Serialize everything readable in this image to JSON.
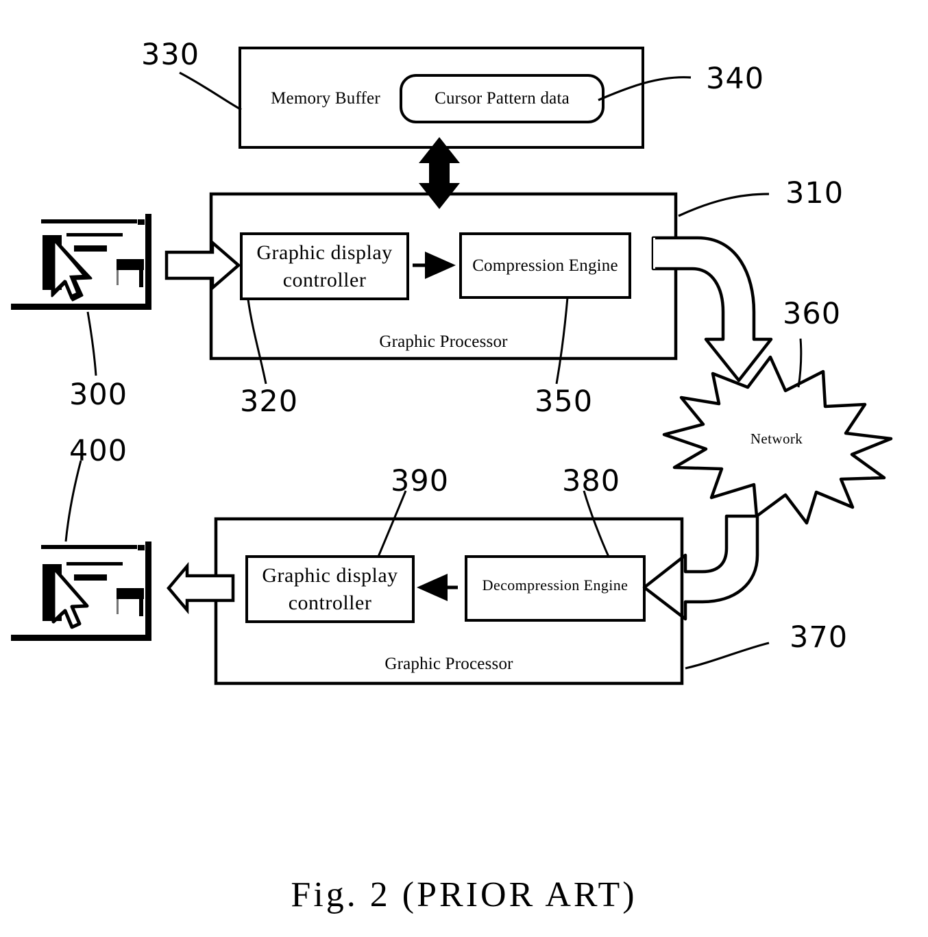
{
  "figure": {
    "caption": "Fig. 2 (PRIOR ART)",
    "domain": "patent-block-diagram"
  },
  "blocks": {
    "memory_buffer": {
      "label": "Memory  Buffer",
      "numeral": "330"
    },
    "cursor_pattern_data": {
      "label": "Cursor Pattern data",
      "numeral": "340"
    },
    "graphic_processor_top": {
      "label": "Graphic  Processor",
      "numeral": "310"
    },
    "graphic_display_controller_top": {
      "label_line1": "Graphic  display",
      "label_line2": "controller",
      "numeral": "320"
    },
    "compression_engine": {
      "label": "Compression Engine",
      "numeral": "350"
    },
    "network": {
      "label": "Network",
      "numeral": "360"
    },
    "graphic_processor_bottom": {
      "label": "Graphic  Processor",
      "numeral": "370"
    },
    "decompression_engine": {
      "label": "Decompression Engine",
      "numeral": "380"
    },
    "graphic_display_controller_bottom": {
      "label_line1": "Graphic  display",
      "label_line2": "controller",
      "numeral": "390"
    },
    "display_top": {
      "numeral": "300",
      "description": "desktop screen thumbnail with mouse cursor"
    },
    "display_bottom": {
      "numeral": "400",
      "description": "desktop screen thumbnail with mouse cursor"
    }
  },
  "colors": {
    "ink": "#000000",
    "paper": "#ffffff"
  }
}
